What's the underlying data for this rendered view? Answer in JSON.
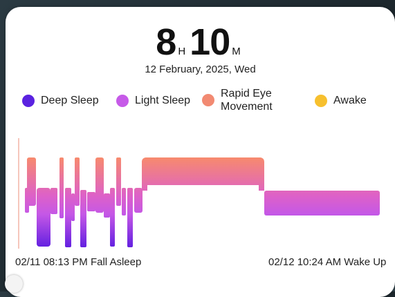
{
  "summary": {
    "hours": "8",
    "hours_unit": "H",
    "minutes": "10",
    "minutes_unit": "M",
    "date": "12 February, 2025, Wed"
  },
  "legend": [
    {
      "label": "Deep Sleep",
      "color": "#5a22e0"
    },
    {
      "label": "Light Sleep",
      "color": "#c65ae8"
    },
    {
      "label": "Rapid Eye Movement",
      "color": "#f28a72"
    },
    {
      "label": "Awake",
      "color": "#f7c02e"
    }
  ],
  "footer": {
    "start": "02/11 08:13 PM Fall Asleep",
    "end": "02/12 10:24 AM Wake Up"
  },
  "colors": {
    "gradient_top": "#f78a6d",
    "gradient_mid": "#d45bd8",
    "gradient_bottom": "#5f1ee0"
  }
}
